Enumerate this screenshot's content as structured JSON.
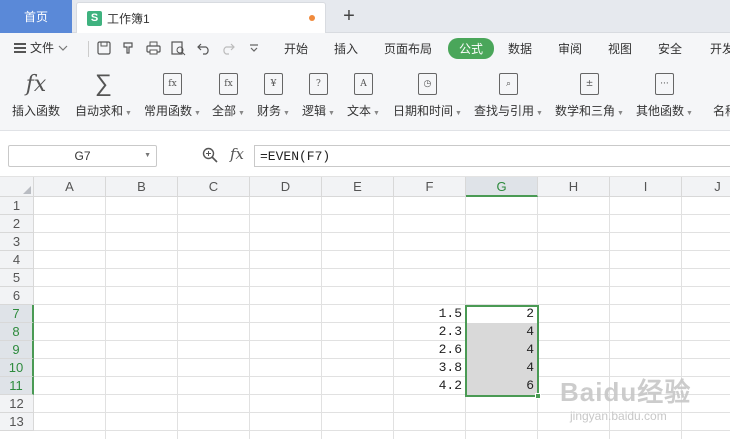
{
  "tabs": {
    "home_label": "首页",
    "doc_icon_letter": "S",
    "doc_title": "工作簿1",
    "add_tab_icon": "+"
  },
  "menu": {
    "file_label": "文件",
    "items": [
      "开始",
      "插入",
      "页面布局",
      "公式",
      "数据",
      "审阅",
      "视图",
      "安全",
      "开发"
    ],
    "active": "公式"
  },
  "ribbon": {
    "buttons": [
      {
        "label": "插入函数",
        "icon": "fx-icon",
        "glyph": "fx"
      },
      {
        "label": "自动求和",
        "icon": "sigma-icon",
        "glyph": "∑"
      },
      {
        "label": "常用函数",
        "icon": "star-fx-icon",
        "glyph": "fx"
      },
      {
        "label": "全部",
        "icon": "all-fx-icon",
        "glyph": "fx"
      },
      {
        "label": "财务",
        "icon": "finance-icon",
        "glyph": "¥"
      },
      {
        "label": "逻辑",
        "icon": "logic-icon",
        "glyph": "?"
      },
      {
        "label": "文本",
        "icon": "text-icon",
        "glyph": "A"
      },
      {
        "label": "日期和时间",
        "icon": "clock-icon",
        "glyph": "◷"
      },
      {
        "label": "查找与引用",
        "icon": "lookup-icon",
        "glyph": "⌕"
      },
      {
        "label": "数学和三角",
        "icon": "math-icon",
        "glyph": "±"
      },
      {
        "label": "其他函数",
        "icon": "more-icon",
        "glyph": "···"
      },
      {
        "label": "名称",
        "icon": "name-icon",
        "glyph": ""
      }
    ]
  },
  "formula_bar": {
    "name_box": "G7",
    "fx_label": "fx",
    "formula": "=EVEN(F7)"
  },
  "grid": {
    "columns": [
      "A",
      "B",
      "C",
      "D",
      "E",
      "F",
      "G",
      "H",
      "I",
      "J"
    ],
    "selected_column": "G",
    "rows": [
      "1",
      "2",
      "3",
      "4",
      "5",
      "6",
      "7",
      "8",
      "9",
      "10",
      "11",
      "12",
      "13"
    ],
    "selected_rows": [
      "7",
      "8",
      "9",
      "10",
      "11"
    ],
    "col_f_values": [
      "1.5",
      "2.3",
      "2.6",
      "3.8",
      "4.2"
    ],
    "col_g_values": [
      "2",
      "4",
      "4",
      "4",
      "6"
    ],
    "selection_color": "#4a9a54"
  },
  "watermark": {
    "main": "Baidu经验",
    "sub": "jingyan.baidu.com"
  }
}
